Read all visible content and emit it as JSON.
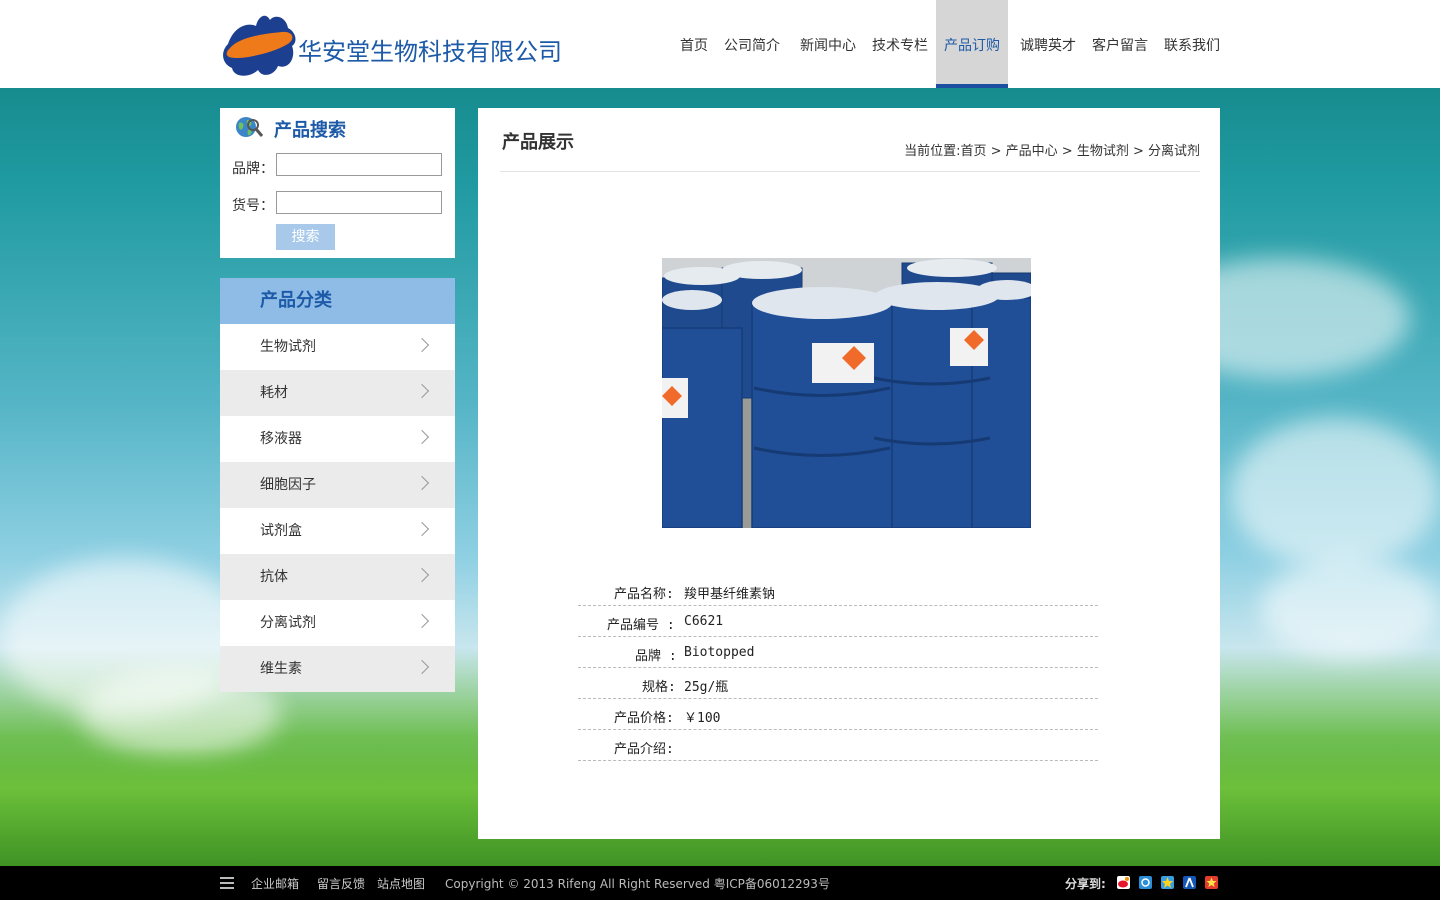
{
  "header": {
    "company_name": "华安堂生物科技有限公司",
    "nav": [
      "首页",
      "公司简介",
      "新闻中心",
      "技术专栏",
      "产品订购",
      "诚聘英才",
      "客户留言",
      "联系我们"
    ],
    "active_nav": "产品订购"
  },
  "search": {
    "title": "产品搜索",
    "brand_label": "品牌：",
    "brand_value": "",
    "code_label": "货号：",
    "code_value": "",
    "button": "搜索"
  },
  "categories": {
    "title": "产品分类",
    "items": [
      "生物试剂",
      "耗材",
      "移液器",
      "细胞因子",
      "试剂盒",
      "抗体",
      "分离试剂",
      "维生素"
    ]
  },
  "main": {
    "title": "产品展示",
    "breadcrumb": "当前位置:首页 > 产品中心 > 生物试剂 > 分离试剂",
    "image_alt": "blue-drums-photo",
    "details": [
      {
        "label": "产品名称:",
        "value": "羧甲基纤维素钠"
      },
      {
        "label": "产品编号 :",
        "value": "C6621"
      },
      {
        "label": "品牌 :",
        "value": "Biotopped"
      },
      {
        "label": "规格:",
        "value": "25g/瓶"
      },
      {
        "label": "产品价格:",
        "value": "￥100"
      },
      {
        "label": "产品介绍:",
        "value": ""
      }
    ]
  },
  "footer": {
    "links": [
      "企业邮箱",
      "留言反馈",
      "站点地图"
    ],
    "copyright": "Copyright © 2013 Rifeng All Right Reserved 粤ICP备06012293号",
    "share_label": "分享到:",
    "share_icons": [
      "weibo-icon",
      "qzone-icon",
      "kaixin-icon",
      "renren-icon",
      "favorite-icon"
    ]
  }
}
